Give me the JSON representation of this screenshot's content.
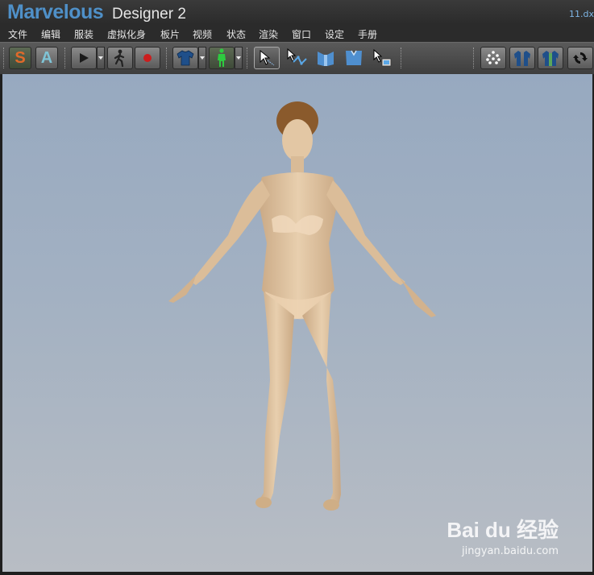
{
  "window": {
    "app_name": "Marvelous",
    "app_sub": "Designer 2",
    "file_name": "11.dx"
  },
  "menu": {
    "items": [
      "文件",
      "编辑",
      "服装",
      "虚拟化身",
      "板片",
      "视频",
      "状态",
      "渲染",
      "窗口",
      "设定",
      "手册"
    ]
  },
  "toolbar": {
    "simulation_button": "S",
    "animation_button": "A",
    "buttons": [
      {
        "name": "simulation",
        "icon": "letter-s-icon"
      },
      {
        "name": "animation",
        "icon": "letter-a-icon"
      },
      {
        "name": "play",
        "icon": "play-icon"
      },
      {
        "name": "walk-motion",
        "icon": "walking-figure-icon"
      },
      {
        "name": "record",
        "icon": "record-icon"
      },
      {
        "name": "garment",
        "icon": "tshirt-icon"
      },
      {
        "name": "avatar",
        "icon": "avatar-icon"
      },
      {
        "name": "select",
        "icon": "cursor-icon"
      },
      {
        "name": "select-mesh",
        "icon": "cursor-mesh-icon"
      },
      {
        "name": "pattern-a",
        "icon": "pattern-icon"
      },
      {
        "name": "pattern-b",
        "icon": "pattern-icon"
      },
      {
        "name": "texture-select",
        "icon": "cursor-texture-icon"
      },
      {
        "name": "points",
        "icon": "points-icon"
      },
      {
        "name": "garment-back",
        "icon": "garment-back-icon"
      },
      {
        "name": "garment-front",
        "icon": "garment-front-icon"
      },
      {
        "name": "refresh",
        "icon": "refresh-icon"
      }
    ],
    "colors": {
      "s_letter": "#e06a2a",
      "a_letter": "#7fc4d6",
      "record": "#cc1e1e",
      "avatar": "#2ecc40",
      "shirt": "#1f4f8a"
    }
  },
  "viewport": {
    "subject": "avatar-figure",
    "skin_color": "#e3c7a4",
    "hair_color": "#8a5a2c"
  },
  "watermark": {
    "logo": "Bai du 经验",
    "url": "jingyan.baidu.com"
  }
}
